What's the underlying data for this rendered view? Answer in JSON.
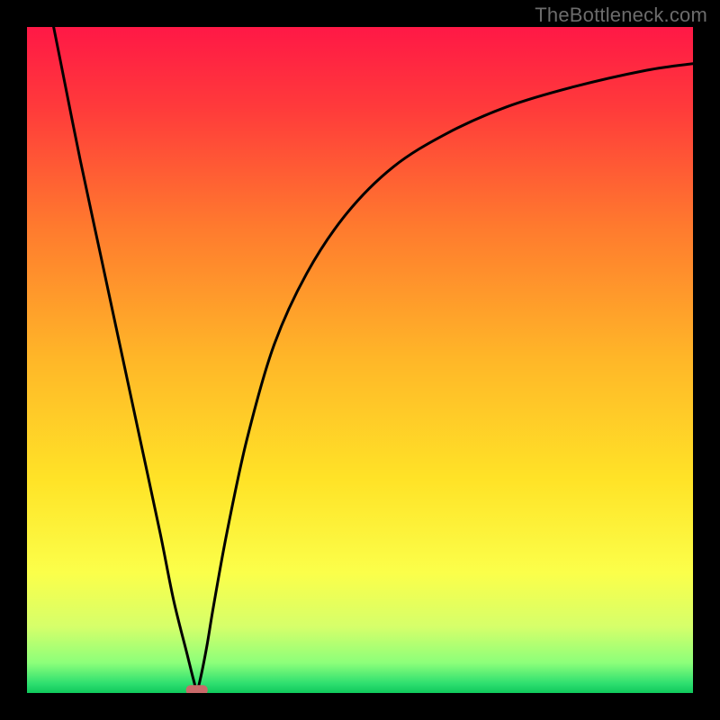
{
  "watermark": "TheBottleneck.com",
  "chart_data": {
    "type": "line",
    "title": "",
    "xlabel": "",
    "ylabel": "",
    "xlim": [
      0,
      100
    ],
    "ylim": [
      0,
      100
    ],
    "grid": false,
    "series": [
      {
        "name": "curve",
        "x": [
          4,
          5,
          8,
          11,
          14,
          17,
          20,
          22,
          24,
          25,
          25.5,
          26,
          27,
          28,
          30,
          33,
          37,
          42,
          48,
          55,
          63,
          72,
          82,
          93,
          100
        ],
        "y": [
          100,
          95,
          80,
          66,
          52,
          38,
          24,
          14,
          6,
          2,
          0.5,
          2,
          7,
          13,
          24,
          38,
          52,
          63,
          72,
          79,
          84,
          88,
          91,
          93.5,
          94.5
        ]
      }
    ],
    "marker": {
      "x": 25.5,
      "y": 0.5
    },
    "background_gradient": {
      "stops": [
        {
          "offset": 0.0,
          "color": "#ff1846"
        },
        {
          "offset": 0.12,
          "color": "#ff3a3b"
        },
        {
          "offset": 0.3,
          "color": "#ff7a2e"
        },
        {
          "offset": 0.5,
          "color": "#ffb728"
        },
        {
          "offset": 0.68,
          "color": "#ffe327"
        },
        {
          "offset": 0.82,
          "color": "#fbff4a"
        },
        {
          "offset": 0.9,
          "color": "#d6ff6a"
        },
        {
          "offset": 0.955,
          "color": "#8cff7a"
        },
        {
          "offset": 0.985,
          "color": "#30e070"
        },
        {
          "offset": 1.0,
          "color": "#0fc95c"
        }
      ]
    },
    "curve_color": "#000000",
    "marker_color": "#c96a6a"
  }
}
